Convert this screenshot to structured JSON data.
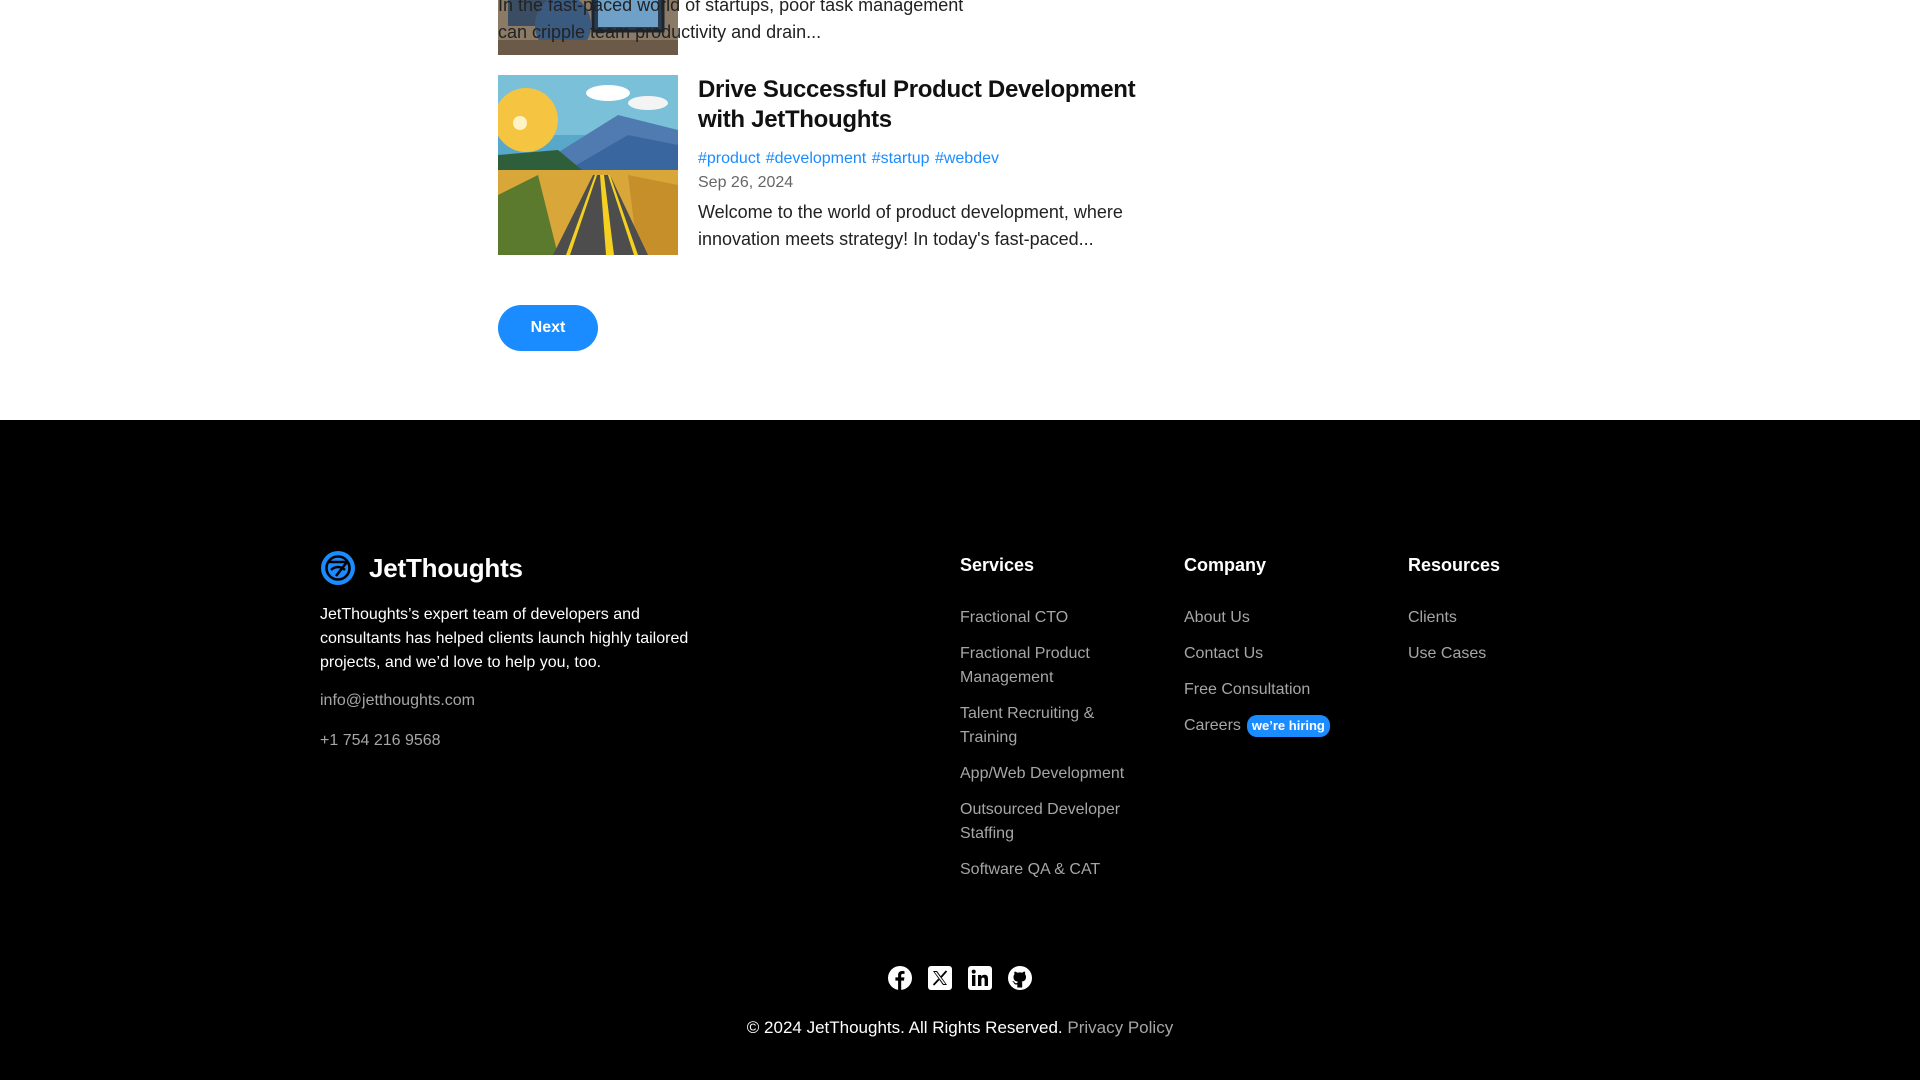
{
  "posts": [
    {
      "excerpt": "In the fast-paced world of startups, poor task management can cripple team productivity and drain..."
    },
    {
      "title": "Drive Successful Product Development with JetThoughts",
      "tags": [
        "#product",
        "#development",
        "#startup",
        "#webdev"
      ],
      "date": "Sep 26, 2024",
      "excerpt": "Welcome to the world of product development, where innovation meets strategy! In today's fast-paced..."
    }
  ],
  "pagination": {
    "next_label": "Next"
  },
  "footer": {
    "brand_name": "JetThoughts",
    "description": "JetThoughts’s expert team of developers and consultants has helped clients launch highly tailored projects, and we’d love to help you, too.",
    "email": "info@jetthoughts.com",
    "phone": "+1 754 216 9568",
    "columns": {
      "services": {
        "heading": "Services",
        "items": [
          "Fractional CTO",
          "Fractional Product Management",
          "Talent Recruiting & Training",
          "App/Web Development",
          "Outsourced Developer Staffing",
          "Software QA & CAT"
        ]
      },
      "company": {
        "heading": "Company",
        "items": [
          "About Us",
          "Contact Us",
          "Free Consultation",
          "Careers"
        ],
        "careers_badge": "we’re hiring"
      },
      "resources": {
        "heading": "Resources",
        "items": [
          "Clients",
          "Use Cases"
        ]
      }
    },
    "social": [
      "facebook-icon",
      "x-icon",
      "linkedin-icon",
      "github-icon"
    ],
    "copyright": "© 2024 JetThoughts. All Rights Reserved.",
    "privacy_label": "Privacy Policy"
  },
  "colors": {
    "accent": "#1a8cff",
    "footer_bg": "#000000",
    "muted": "#a6a6a6"
  }
}
